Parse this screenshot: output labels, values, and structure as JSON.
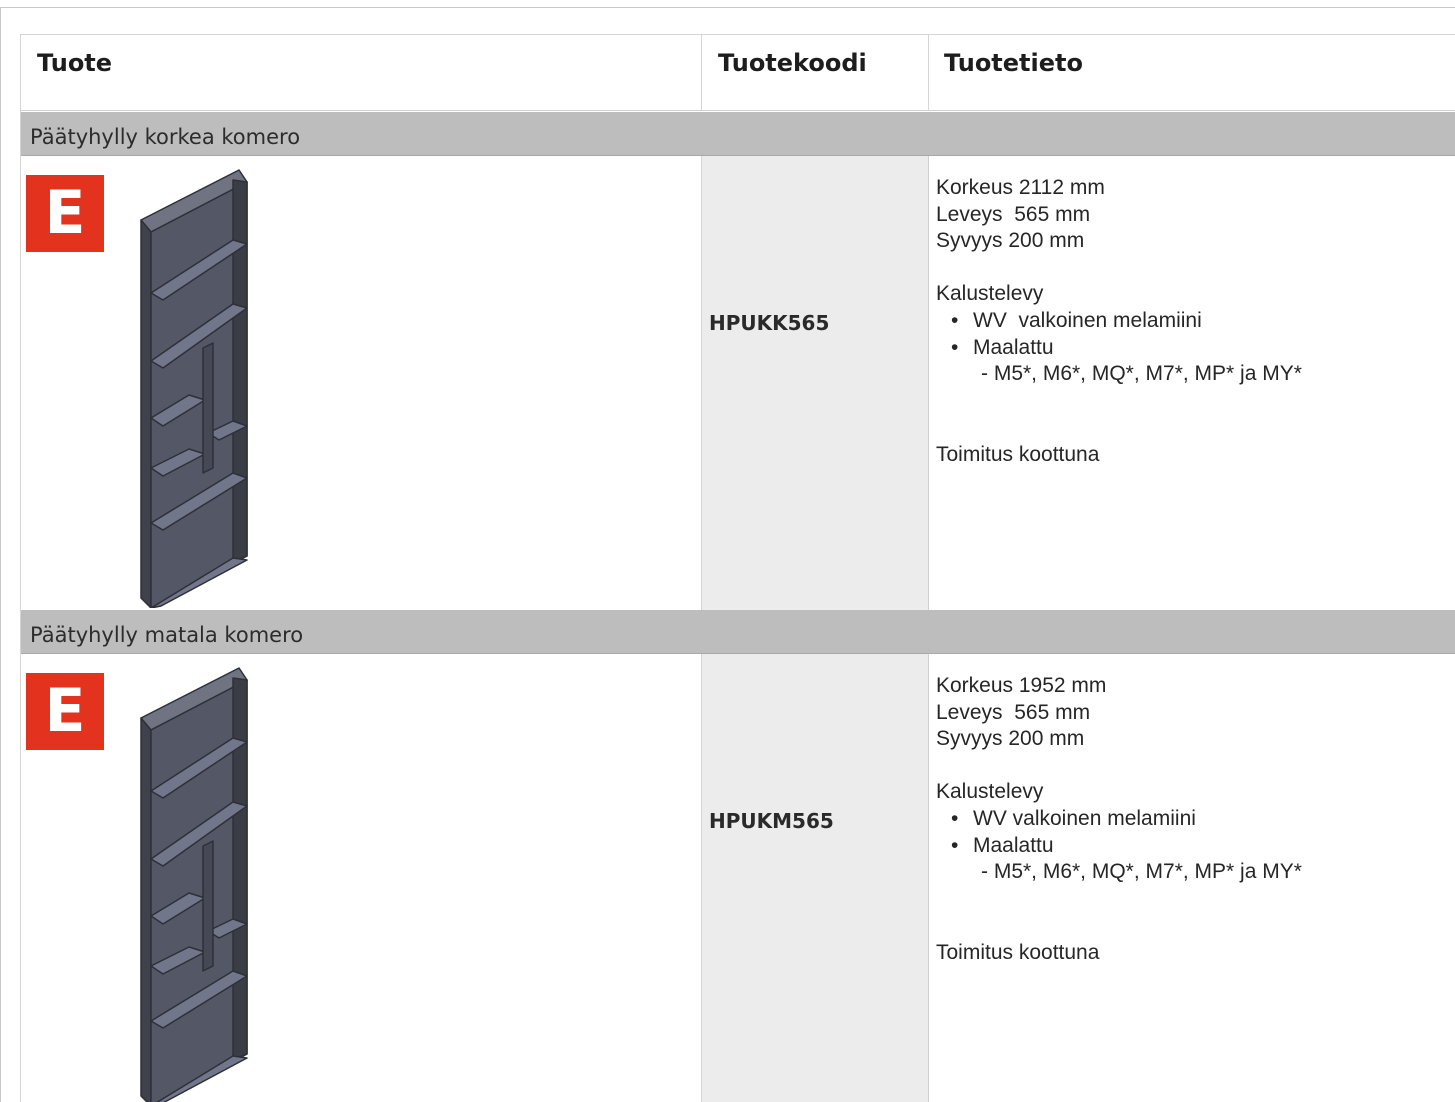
{
  "header": {
    "col1": "Tuote",
    "col2": "Tuotekoodi",
    "col3": "Tuotetieto"
  },
  "products": [
    {
      "section_title": "Päätyhylly korkea komero",
      "badge": "E",
      "image_icon": "shelf-unit-icon",
      "code": "HPUKK565",
      "height": "Korkeus 2112 mm",
      "width": "Leveys  565 mm",
      "depth": "Syvyys 200 mm",
      "material_title": "Kalustelevy",
      "bullets": [
        "WV  valkoinen melamiini",
        "Maalattu"
      ],
      "sub": "- M5*, M6*, MQ*, M7*, MP* ja MY*",
      "delivery": "Toimitus koottuna"
    },
    {
      "section_title": "Päätyhylly matala komero",
      "badge": "E",
      "image_icon": "shelf-unit-icon",
      "code": "HPUKM565",
      "height": "Korkeus 1952 mm",
      "width": "Leveys  565 mm",
      "depth": "Syvyys 200 mm",
      "material_title": "Kalustelevy",
      "bullets": [
        "WV valkoinen melamiini",
        "Maalattu"
      ],
      "sub": "- M5*, M6*, MQ*, M7*, MP* ja MY*",
      "delivery": "Toimitus koottuna"
    }
  ],
  "colors": {
    "badge": "#e3321e",
    "section_bar": "#bdbdbd",
    "code_column": "#ececec",
    "shelf": "#545866"
  }
}
